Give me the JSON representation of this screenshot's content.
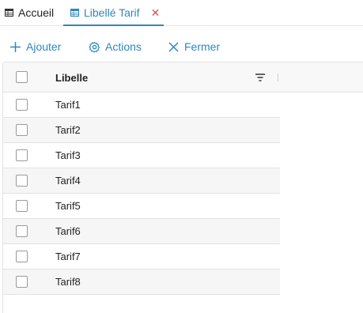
{
  "tabs": [
    {
      "label": "Accueil",
      "icon": "table-icon",
      "active": false
    },
    {
      "label": "Libellé Tarif",
      "icon": "table-icon",
      "active": true,
      "close": "✕"
    }
  ],
  "toolbar": {
    "add_label": "Ajouter",
    "actions_label": "Actions",
    "close_label": "Fermer"
  },
  "grid": {
    "column_header": "Libelle",
    "rows": [
      "Tarif1",
      "Tarif2",
      "Tarif3",
      "Tarif4",
      "Tarif5",
      "Tarif6",
      "Tarif7",
      "Tarif8"
    ]
  },
  "colors": {
    "accent": "#2e86c1",
    "close": "#d9534f",
    "row_alt": "#f6f6f6"
  }
}
